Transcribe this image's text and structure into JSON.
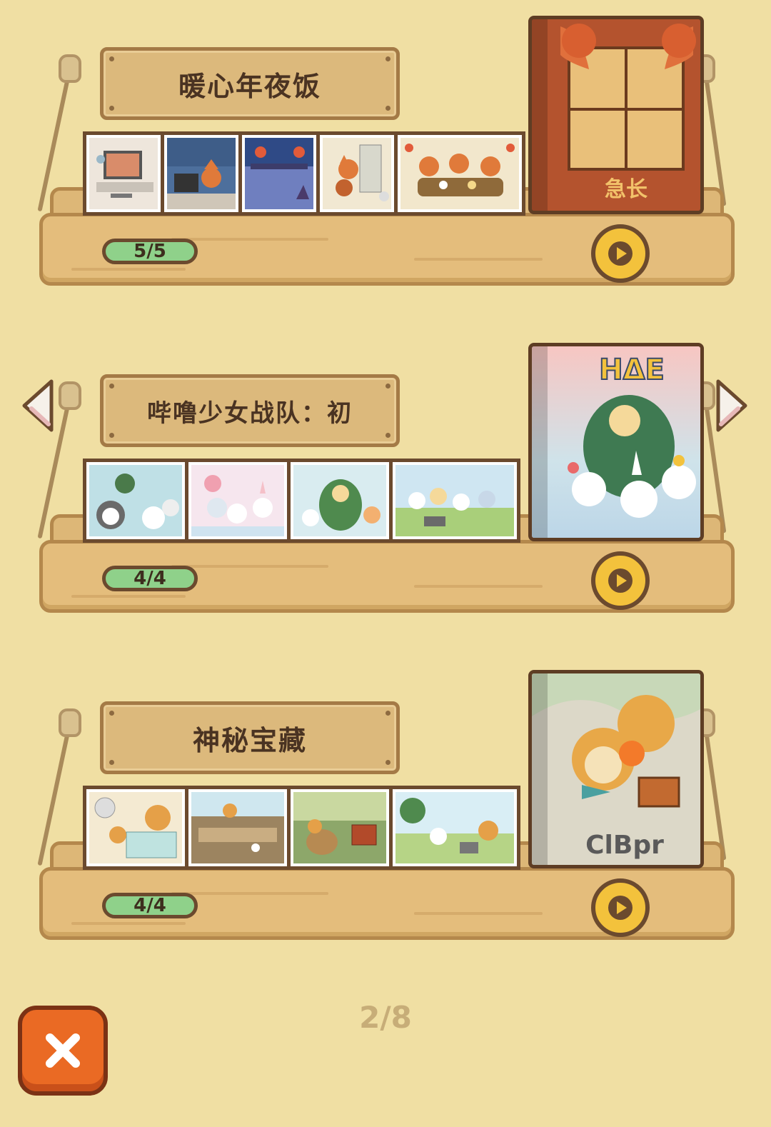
{
  "albums": [
    {
      "title": "暖心年夜饭",
      "progress": "5/5",
      "cover_caption": "急长"
    },
    {
      "title": "哔噜少女战队：初",
      "progress": "4/4",
      "cover_caption": "ΗΔΕ"
    },
    {
      "title": "神秘宝藏",
      "progress": "4/4",
      "cover_caption": "ClBpr"
    }
  ],
  "pager": {
    "label": "2/8"
  },
  "icons": {
    "prev": "chevron-left-icon",
    "next": "chevron-right-icon",
    "play": "play-icon",
    "close": "close-icon"
  },
  "colors": {
    "background": "#f0dfa3",
    "progress_fill": "#8fd18a",
    "play_button": "#f3c23c",
    "close_button": "#ea6a24"
  }
}
